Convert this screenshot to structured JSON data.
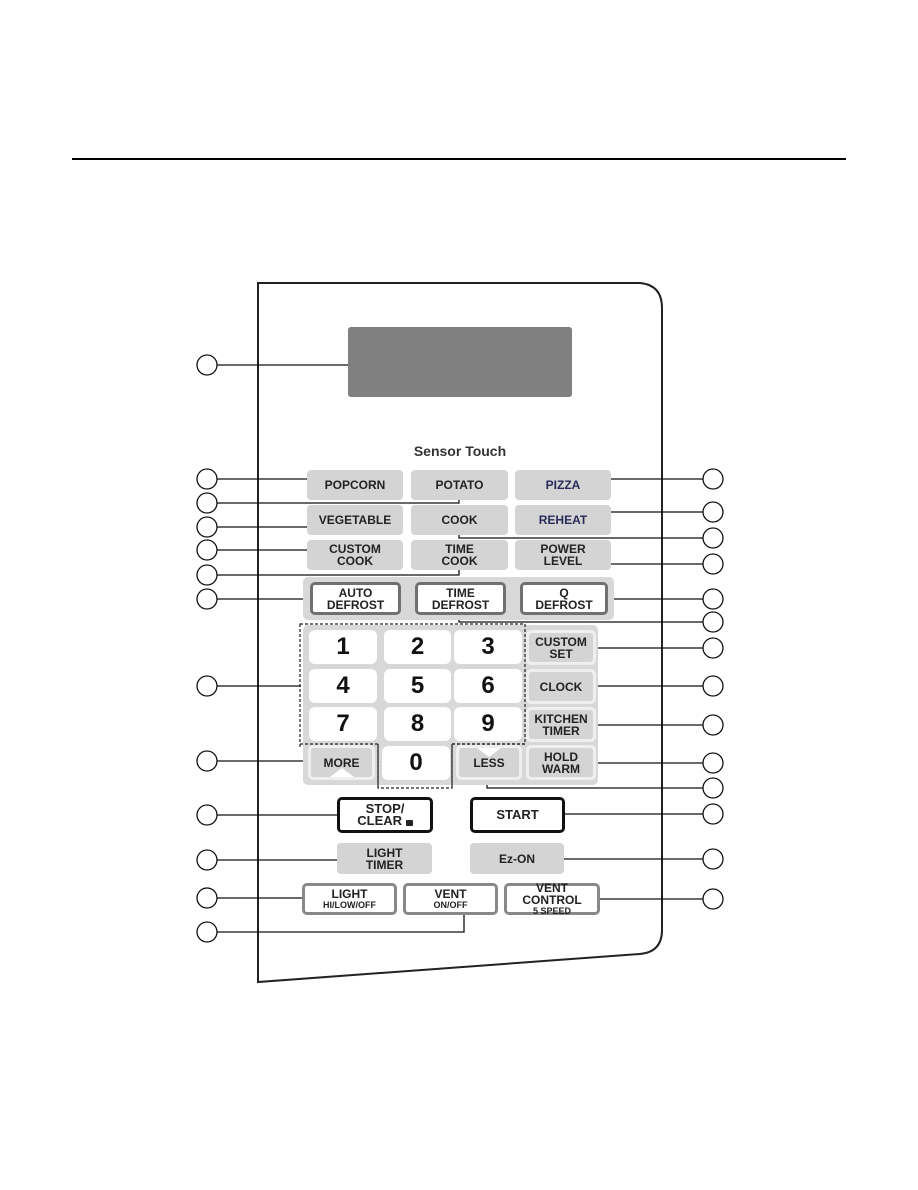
{
  "panel": {
    "title": "Sensor Touch",
    "sensor_row1": [
      "POPCORN",
      "POTATO",
      "PIZZA"
    ],
    "sensor_row2": [
      "VEGETABLE",
      "COOK",
      "REHEAT"
    ],
    "sensor_row3": [
      [
        "CUSTOM",
        "COOK"
      ],
      [
        "TIME",
        "COOK"
      ],
      [
        "POWER",
        "LEVEL"
      ]
    ],
    "defrost": [
      [
        "AUTO",
        "DEFROST"
      ],
      [
        "TIME",
        "DEFROST"
      ],
      [
        "Q",
        "DEFROST"
      ]
    ],
    "keypad": [
      "1",
      "2",
      "3",
      "4",
      "5",
      "6",
      "7",
      "8",
      "9",
      "0"
    ],
    "more": "MORE",
    "less": "LESS",
    "side": [
      [
        "CUSTOM",
        "SET"
      ],
      [
        "CLOCK",
        ""
      ],
      [
        "KITCHEN",
        "TIMER"
      ],
      [
        "HOLD",
        "WARM"
      ]
    ],
    "stop": [
      "STOP/",
      "CLEAR"
    ],
    "start": "START",
    "light_timer": [
      "LIGHT",
      "TIMER"
    ],
    "ez_on": "Ez-ON",
    "light": [
      "LIGHT",
      "HI/LOW/OFF"
    ],
    "vent": [
      "VENT",
      "ON/OFF"
    ],
    "vent_control": [
      "VENT CONTROL",
      "5 SPEED"
    ]
  }
}
